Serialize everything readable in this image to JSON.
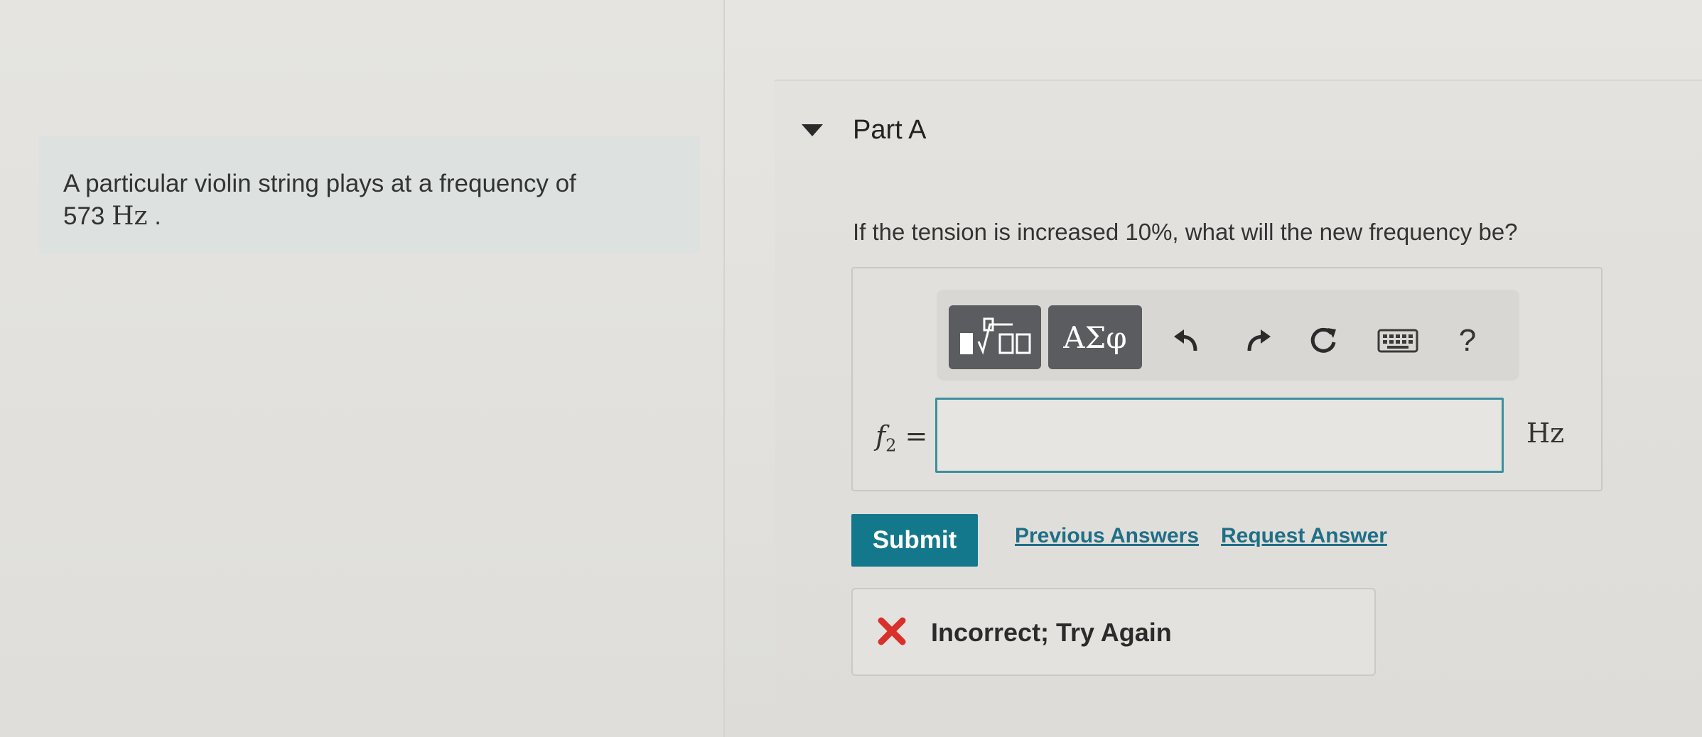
{
  "problem": {
    "text": "A particular violin string plays at a frequency of",
    "value": "573",
    "unit": "Hz",
    "period": "."
  },
  "part": {
    "title": "Part A",
    "question": "If the tension is increased 10%, what will the new frequency be?"
  },
  "toolbar": {
    "greek_label": "ΑΣφ",
    "help_label": "?",
    "icons": [
      "templates-icon",
      "greek-symbols-icon",
      "undo-icon",
      "redo-icon",
      "reset-icon",
      "keyboard-icon",
      "help-icon"
    ]
  },
  "answer": {
    "variable": "f",
    "subscript": "2",
    "equals": "=",
    "value": "",
    "unit": "Hz"
  },
  "actions": {
    "submit_label": "Submit",
    "previous_answers_label": "Previous Answers",
    "request_answer_label": "Request Answer"
  },
  "feedback": {
    "text": "Incorrect; Try Again",
    "status_color": "#d9302b"
  },
  "colors": {
    "accent": "#14788c",
    "link": "#1f6f86",
    "input_border": "#3c8f9f",
    "toolbar_button": "#5b5c5f"
  }
}
